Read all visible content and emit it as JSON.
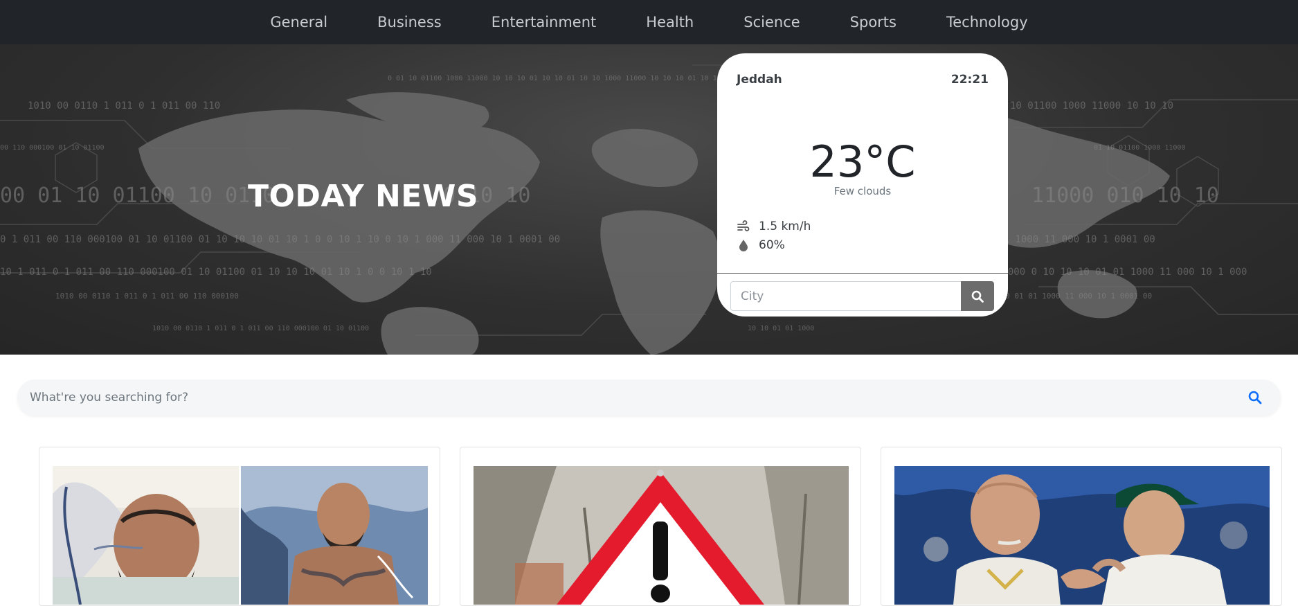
{
  "nav": {
    "items": [
      "General",
      "Business",
      "Entertainment",
      "Health",
      "Science",
      "Sports",
      "Technology"
    ]
  },
  "hero": {
    "title": "TODAY NEWS"
  },
  "weather": {
    "city": "Jeddah",
    "time": "22:21",
    "temperature": "23°C",
    "description": "Few clouds",
    "wind": "1.5 km/h",
    "humidity": "60%",
    "city_placeholder": "City",
    "wind_icon": "wind-icon",
    "humidity_icon": "droplet-icon",
    "search_icon": "search-icon"
  },
  "search": {
    "placeholder": "What're you searching for?",
    "icon": "search-icon",
    "accent": "#0d6efd"
  },
  "colors": {
    "navbar": "#212529",
    "nav_text": "#c9ccd0",
    "hero_bg": "#2f2f2f",
    "weather_button": "#6c6c6c"
  },
  "cards": [
    {
      "image": "Man in hospital bed with oxygen tube beside photo of tattooed fighter in boxing ring"
    },
    {
      "image": "Red warning triangle road sign with exclamation mark"
    },
    {
      "image": "Two cricket players in team caps talking on the field"
    }
  ]
}
